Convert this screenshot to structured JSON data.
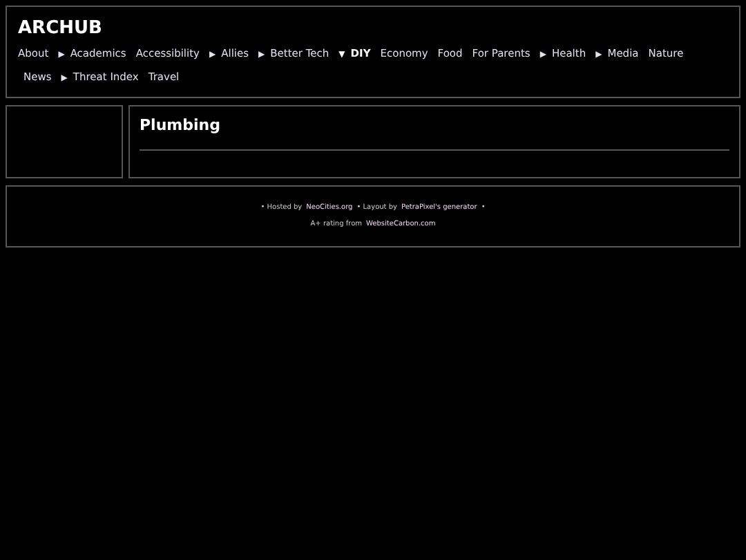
{
  "site_title": "ARCHUB",
  "nav": [
    {
      "label": "About",
      "expanded": false
    },
    {
      "label": "Academics",
      "marker": "▶",
      "expanded": false
    },
    {
      "label": "Accessibility",
      "expanded": false
    },
    {
      "label": "Allies",
      "marker": "▶",
      "expanded": false
    },
    {
      "label": "Better Tech",
      "marker": "▶",
      "expanded": false
    },
    {
      "label": "DIY",
      "marker": "▼",
      "expanded": true
    },
    {
      "label": "Economy",
      "expanded": false
    },
    {
      "label": "Food",
      "expanded": false
    },
    {
      "label": "For Parents",
      "expanded": false
    },
    {
      "label": "Health",
      "marker": "▶",
      "expanded": false
    },
    {
      "label": "Media",
      "marker": "▶",
      "expanded": false
    },
    {
      "label": "Nature",
      "expanded": false
    },
    {
      "label": "News",
      "expanded": false
    },
    {
      "label": "Threat Index",
      "marker": "▶",
      "expanded": false
    },
    {
      "label": "Travel",
      "expanded": false
    }
  ],
  "page_heading": "Plumbing",
  "footer": [
    [
      {
        "text": "• Hosted by",
        "kind": "text"
      },
      {
        "text": "NeoCities.org",
        "kind": "link"
      },
      {
        "text": "• Layout by",
        "kind": "text"
      },
      {
        "text": "PetraPixel's generator",
        "kind": "link"
      },
      {
        "text": "•",
        "kind": "text"
      }
    ],
    [
      {
        "text": "A+ rating from",
        "kind": "text"
      },
      {
        "text": "WebsiteCarbon.com",
        "kind": "link"
      }
    ]
  ]
}
